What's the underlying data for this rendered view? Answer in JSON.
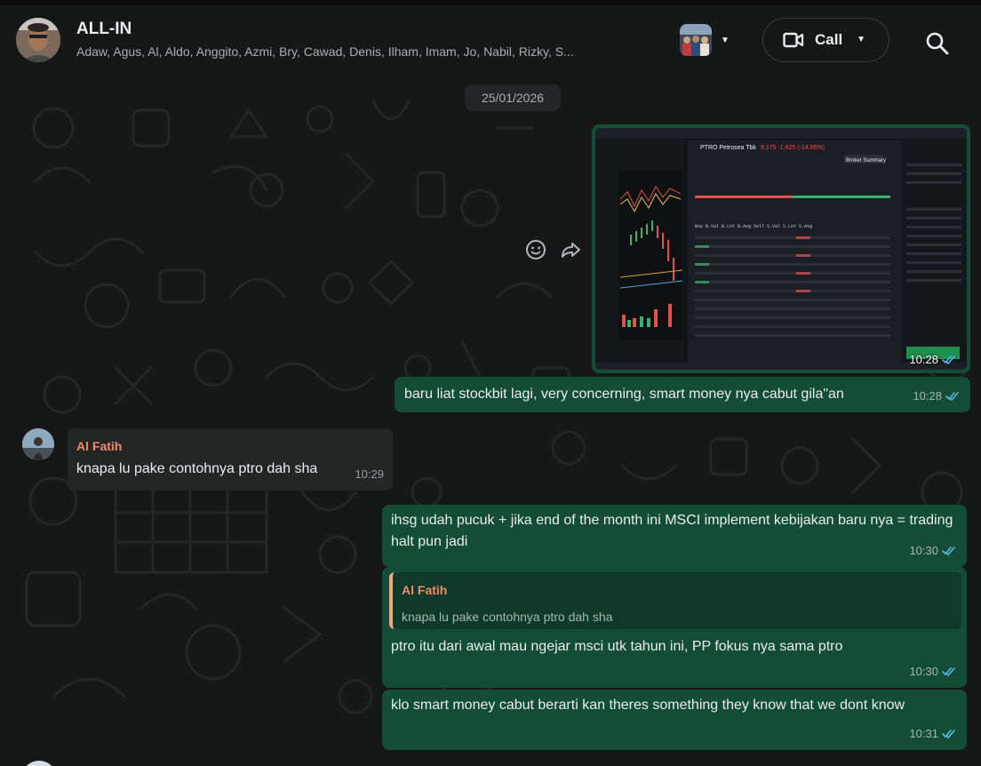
{
  "header": {
    "title": "ALL-IN",
    "members": "Adaw, Agus, Al, Aldo, Anggito, Azmi, Bry, Cawad, Denis, Ilham, Imam, Jo, Nabil, Rizky, S...",
    "call_label": "Call"
  },
  "chat": {
    "date": "25/01/2026",
    "messages": [
      {
        "id": "m1",
        "direction": "out",
        "type": "image",
        "time": "10:28",
        "status": "read",
        "image": {
          "app_symbol": "PTRO",
          "company": "Petrosea Tbk",
          "price": "9,175",
          "change": "-1,625 (-14.05%)",
          "tab": "Broker Summary",
          "ohlc": "O 10,800 H 10,900 L 9,175 C 9,175",
          "reply_btn": "Buy"
        }
      },
      {
        "id": "m2",
        "direction": "out",
        "type": "text",
        "text": "baru liat stockbit lagi, very concerning, smart money nya cabut gila\"an",
        "time": "10:28",
        "status": "read"
      },
      {
        "id": "m3",
        "direction": "in",
        "type": "text",
        "sender": "Al Fatih",
        "text": "knapa lu pake contohnya ptro dah sha",
        "time": "10:29"
      },
      {
        "id": "m4",
        "direction": "out",
        "type": "text",
        "text": "ihsg udah pucuk + jika end of the month ini MSCI implement kebijakan baru nya = trading halt pun jadi",
        "time": "10:30",
        "status": "read"
      },
      {
        "id": "m5",
        "direction": "out",
        "type": "reply",
        "quote_sender": "Al Fatih",
        "quote_text": "knapa lu pake contohnya ptro dah sha",
        "text": "ptro itu dari awal mau ngejar msci utk tahun ini, PP fokus nya sama ptro",
        "time": "10:30",
        "status": "read"
      },
      {
        "id": "m6",
        "direction": "out",
        "type": "text",
        "text": "klo smart money cabut berarti kan theres something they know that we dont know",
        "time": "10:31",
        "status": "read"
      }
    ]
  },
  "colors": {
    "outgoing": "#144d37",
    "incoming": "#242626",
    "read_ticks": "#53bdeb",
    "sender_name": "#ef8a66",
    "background": "#161717"
  },
  "icons": {
    "call": "video-camera-icon",
    "search": "search-icon",
    "emoji": "emoji-icon",
    "forward": "forward-icon",
    "read": "double-check-icon"
  }
}
